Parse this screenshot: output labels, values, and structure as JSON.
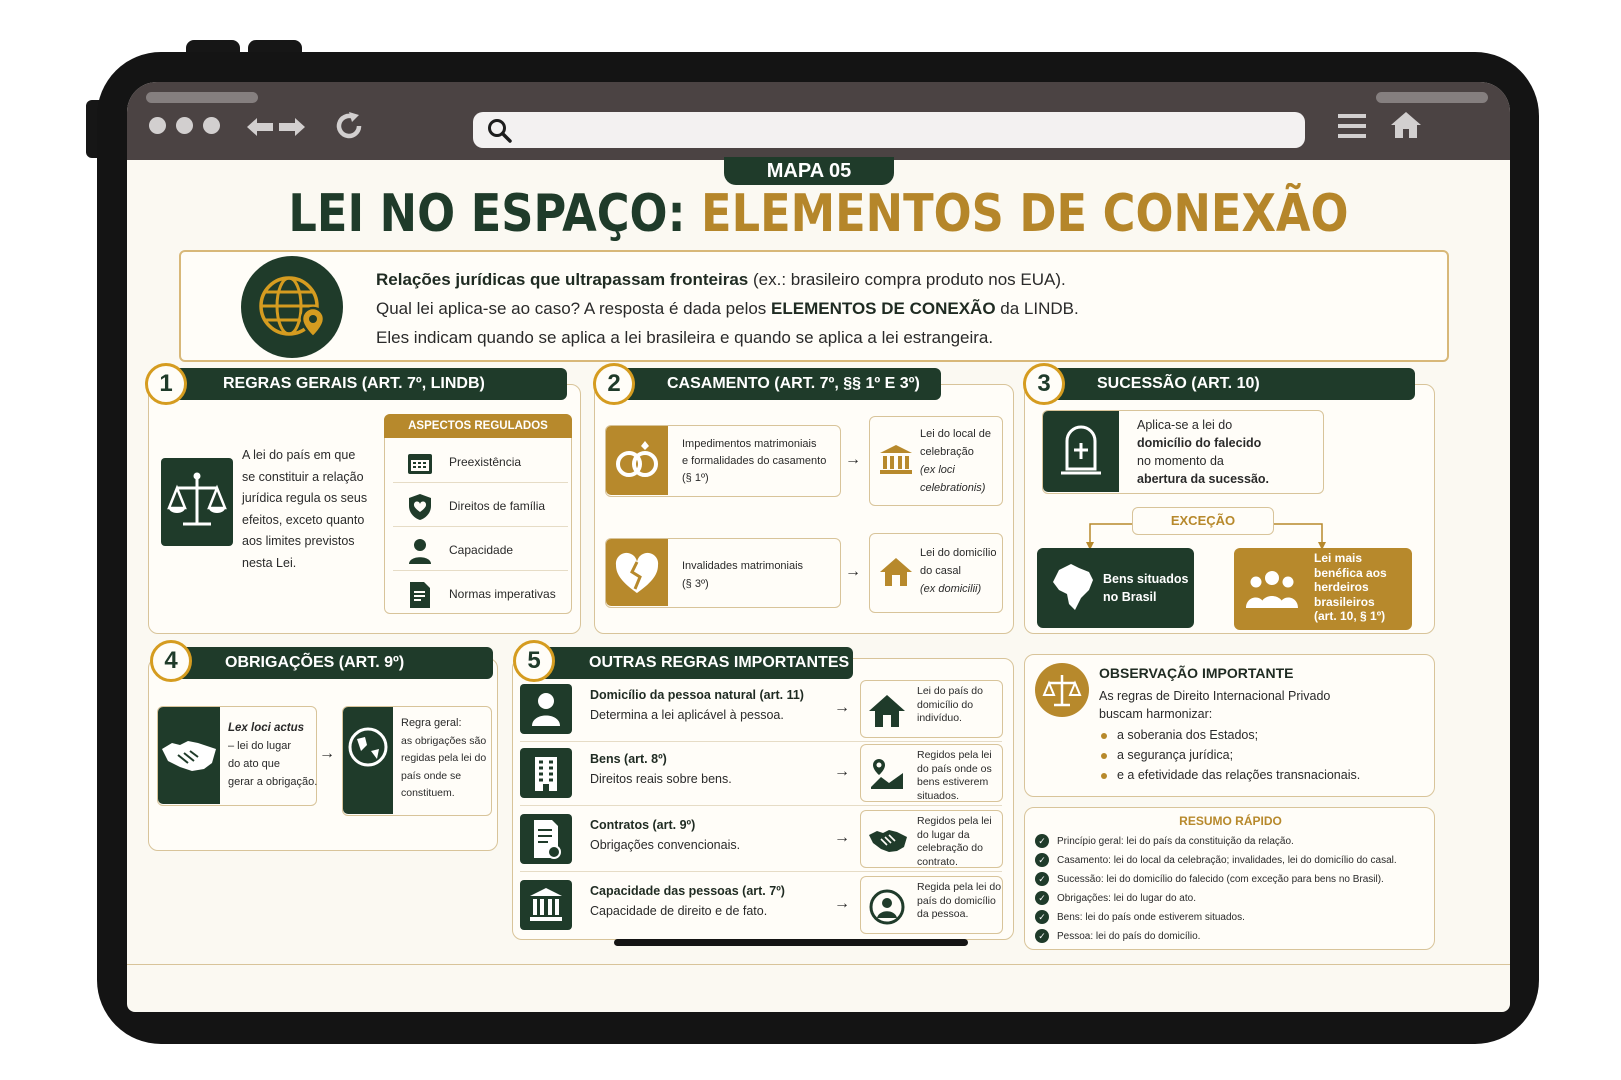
{
  "badge": "MAPA 05",
  "title": {
    "part1": "LEI NO ESPAÇO:",
    "part2": "ELEMENTOS DE CONEXÃO"
  },
  "intro": {
    "l1_bold": "Relações jurídicas que ultrapassam fronteiras",
    "l1_rest": " (ex.: brasileiro compra produto nos EUA).",
    "l2_a": "Qual lei aplica-se ao caso? A resposta é dada pelos ",
    "l2_bold": "ELEMENTOS DE CONEXÃO",
    "l2_b": " da LINDB.",
    "l3": "Eles indicam quando se aplica a lei brasileira e quando se aplica a lei estrangeira."
  },
  "s1": {
    "num": "1",
    "title": "REGRAS GERAIS (ART. 7º, LINDB)",
    "text": [
      "A lei do país em que",
      "se constituir a relação",
      "jurídica regula os seus",
      "efeitos, exceto quanto",
      "aos limites previstos",
      "nesta Lei."
    ],
    "aspects_title": "ASPECTOS REGULADOS",
    "aspects": [
      "Preexistência",
      "Direitos de família",
      "Capacidade",
      "Normas imperativas"
    ]
  },
  "s2": {
    "num": "2",
    "title": "CASAMENTO (ART. 7º, §§ 1º E 3º)",
    "r1_left": [
      "Impedimentos matrimoniais",
      "e formalidades do casamento",
      "(§ 1º)"
    ],
    "r1_right": [
      "Lei do local de",
      "celebração"
    ],
    "r1_right_it": [
      "(ex loci",
      "celebrationis)"
    ],
    "r2_left": [
      "Invalidades matrimoniais",
      "(§ 3º)"
    ],
    "r2_right": [
      "Lei do domicílio",
      "do casal"
    ],
    "r2_right_it": [
      "(ex domicilii)"
    ]
  },
  "s3": {
    "num": "3",
    "title": "SUCESSÃO (ART. 10)",
    "main_a": "Aplica-se a lei do",
    "main_b": "domicílio do falecido",
    "main_c": "no momento da",
    "main_d": "abertura da sucessão.",
    "exception": "EXCEÇÃO",
    "left": [
      "Bens situados",
      "no Brasil"
    ],
    "right": [
      "Lei mais",
      "benéfica aos",
      "herdeiros",
      "brasileiros",
      "(art. 10, § 1º)"
    ]
  },
  "s4": {
    "num": "4",
    "title": "OBRIGAÇÕES (ART. 9º)",
    "left_it": "Lex loci actus",
    "left": [
      "– lei do lugar",
      "do ato que",
      "gerar a obrigação."
    ],
    "right": [
      "Regra geral:",
      "as obrigações são",
      "regidas pela lei do",
      "país onde se",
      "constituem."
    ]
  },
  "s5": {
    "num": "5",
    "title": "OUTRAS REGRAS IMPORTANTES",
    "rows": [
      {
        "h": "Domicílio da pessoa natural (art. 11)",
        "s": "Determina a lei aplicável à pessoa.",
        "r": [
          "Lei do país do",
          "domicílio do",
          "indivíduo."
        ]
      },
      {
        "h": "Bens (art. 8º)",
        "s": "Direitos reais sobre bens.",
        "r": [
          "Regidos pela lei",
          "do país onde os",
          "bens estiverem",
          "situados."
        ]
      },
      {
        "h": "Contratos (art. 9º)",
        "s": "Obrigações convencionais.",
        "r": [
          "Regidos pela lei",
          "do lugar da",
          "celebração do",
          "contrato."
        ]
      },
      {
        "h": "Capacidade das pessoas (art. 7º)",
        "s": "Capacidade de direito e de fato.",
        "r": [
          "Regida pela lei do",
          "país do domicílio",
          "da pessoa."
        ]
      }
    ]
  },
  "obs": {
    "title": "OBSERVAÇÃO IMPORTANTE",
    "text": [
      "As regras de Direito Internacional Privado",
      "buscam harmonizar:"
    ],
    "bullets": [
      "a soberania dos Estados;",
      "a segurança jurídica;",
      "e a efetividade das relações transnacionais."
    ]
  },
  "summary": {
    "title": "RESUMO RÁPIDO",
    "items": [
      "Princípio geral: lei do país da constituição da relação.",
      "Casamento: lei do local da celebração; invalidades, lei do domicílio do casal.",
      "Sucessão: lei do domicílio do falecido (com exceção para bens no Brasil).",
      "Obrigações: lei do lugar do ato.",
      "Bens: lei do país onde estiverem situados.",
      "Pessoa: lei do país do domicílio."
    ]
  },
  "colors": {
    "green": "#1f3b2a",
    "gold": "#b5862a",
    "orange": "#d59c20"
  },
  "icons": [
    "search-icon",
    "back-icon",
    "forward-icon",
    "reload-icon",
    "menu-icon",
    "home-icon",
    "globe-pin-icon",
    "scales-icon",
    "calendar-icon",
    "shield-icon",
    "person-icon",
    "document-icon",
    "rings-icon",
    "broken-heart-icon",
    "courthouse-icon",
    "house-icon",
    "tombstone-icon",
    "brazil-map-icon",
    "people-icon",
    "handshake-icon",
    "world-icon",
    "building-icon",
    "contract-icon",
    "bank-icon",
    "land-icon",
    "user-circle-icon",
    "check-icon"
  ]
}
